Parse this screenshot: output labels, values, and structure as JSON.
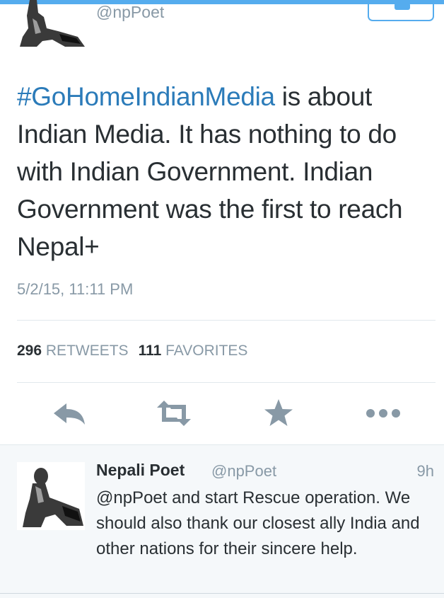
{
  "top": {
    "handle": "@npPoet"
  },
  "tweet": {
    "hashtag": "#GoHomeIndianMedia",
    "text_rest": " is about Indian Media. It has nothing to do with Indian Government. Indian Government was the first to reach Nepal+",
    "timestamp": "5/2/15, 11:11 PM",
    "retweets_count": "296",
    "retweets_label": "RETWEETS",
    "favorites_count": "111",
    "favorites_label": "FAVORITES"
  },
  "actions": [
    {
      "name": "reply",
      "icon": "reply-icon"
    },
    {
      "name": "retweet",
      "icon": "retweet-icon"
    },
    {
      "name": "favorite",
      "icon": "star-icon"
    },
    {
      "name": "more",
      "icon": "more-icon"
    }
  ],
  "reply": {
    "name": "Nepali Poet",
    "handle": "@npPoet",
    "time": "9h",
    "text": "@npPoet and start Rescue operation. We should also thank our closest ally India and other nations for their sincere help."
  },
  "colors": {
    "accent": "#55acee",
    "link": "#2b7bb9",
    "text": "#292f33",
    "muted": "#8899a6",
    "icon": "#8899a6"
  }
}
